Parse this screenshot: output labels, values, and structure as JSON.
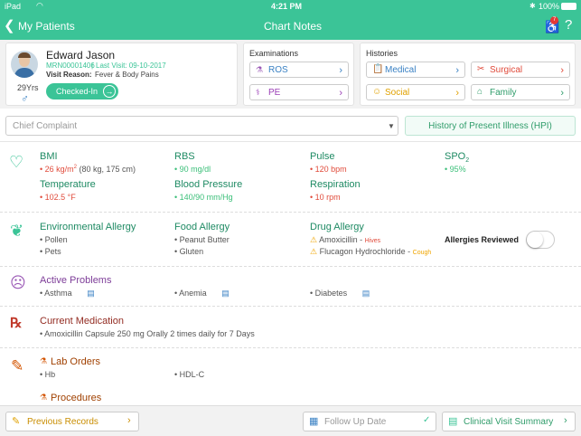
{
  "status": {
    "device": "iPad",
    "time": "4:21 PM",
    "battery": "100%"
  },
  "nav": {
    "back_label": "My Patients",
    "title": "Chart Notes",
    "badge": "7",
    "help": "?"
  },
  "patient": {
    "name": "Edward Jason",
    "mrn": "MRN00001406",
    "last_visit": "Last Visit: 09-10-2017",
    "reason_label": "Visit Reason:",
    "reason_value": "Fever & Body Pains",
    "age": "29Yrs",
    "status": "Checked-In"
  },
  "examinations": {
    "title": "Examinations",
    "items": [
      "ROS",
      "PE"
    ]
  },
  "histories": {
    "title": "Histories",
    "items": [
      "Medical",
      "Surgical",
      "Social",
      "Family"
    ]
  },
  "chief_complaint": {
    "placeholder": "Chief Complaint",
    "hpi_button": "History of Present Illness (HPI)"
  },
  "vitals": {
    "bmi": {
      "label": "BMI",
      "value": "26 kg/m",
      "sup": "2",
      "extra": " (80 kg, 175 cm)"
    },
    "rbs": {
      "label": "RBS",
      "value": "90 mg/dl"
    },
    "pulse": {
      "label": "Pulse",
      "value": "120 bpm"
    },
    "spo2": {
      "label": "SPO",
      "sub": "2",
      "value": "95%"
    },
    "temperature": {
      "label": "Temperature",
      "value": "102.5 °F"
    },
    "bp": {
      "label": "Blood Pressure",
      "value": "140/90 mm/Hg"
    },
    "respiration": {
      "label": "Respiration",
      "value": "10 rpm"
    }
  },
  "allergies": {
    "environmental": {
      "label": "Environmental Allergy",
      "items": [
        "Pollen",
        "Pets"
      ]
    },
    "food": {
      "label": "Food Allergy",
      "items": [
        "Peanut Butter",
        "Gluten"
      ]
    },
    "drug": {
      "label": "Drug Allergy",
      "items": [
        {
          "name": "Amoxicillin",
          "reaction": "Hives"
        },
        {
          "name": "Flucagon Hydrochloride",
          "reaction": "Cough"
        }
      ]
    },
    "reviewed_label": "Allergies Reviewed"
  },
  "problems": {
    "label": "Active Problems",
    "items": [
      "Asthma",
      "Anemia",
      "Diabetes"
    ]
  },
  "medication": {
    "label": "Current Medication",
    "items": [
      "Amoxicillin Capsule 250 mg Orally 2 times daily for 7 Days"
    ]
  },
  "lab": {
    "label": "Lab Orders",
    "items": [
      "Hb",
      "HDL-C"
    ]
  },
  "procedures": {
    "label": "Procedures"
  },
  "bottom": {
    "previous": "Previous Records",
    "followup": "Follow Up Date",
    "summary": "Clinical Visit Summary"
  },
  "colors": {
    "accent": "#3bc497",
    "red": "#e04b3b",
    "green": "#3bbf79",
    "warning": "#f0a500"
  }
}
